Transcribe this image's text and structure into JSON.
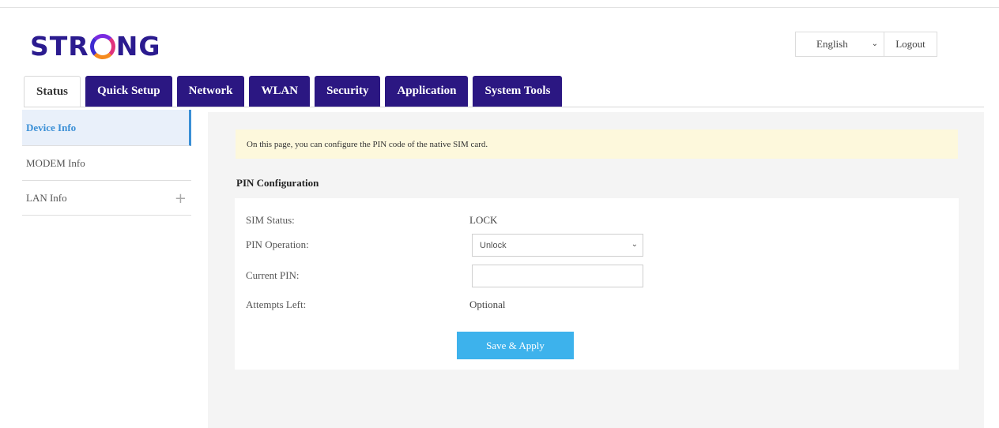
{
  "brand": {
    "logo_text_before": "STR",
    "logo_text_after": "NG",
    "logo_colors": [
      "#2b1b8f",
      "#7a2ae0",
      "#e0327c",
      "#f58a1f"
    ]
  },
  "header": {
    "language": {
      "selected": "English"
    },
    "logout_label": "Logout"
  },
  "tabs": [
    {
      "label": "Status",
      "active": true
    },
    {
      "label": "Quick Setup",
      "active": false
    },
    {
      "label": "Network",
      "active": false
    },
    {
      "label": "WLAN",
      "active": false
    },
    {
      "label": "Security",
      "active": false
    },
    {
      "label": "Application",
      "active": false
    },
    {
      "label": "System Tools",
      "active": false
    }
  ],
  "sidebar": {
    "items": [
      {
        "label": "Device Info",
        "active": true
      },
      {
        "label": "MODEM Info",
        "active": false
      },
      {
        "label": "LAN Info",
        "active": false,
        "expand_icon": "plus-icon"
      }
    ]
  },
  "main": {
    "notice": "On this page, you can configure the PIN code of the native SIM card.",
    "section_title": "PIN Configuration",
    "form": {
      "sim_status": {
        "label": "SIM Status:",
        "value": "LOCK"
      },
      "pin_operation": {
        "label": "PIN Operation:",
        "selected": "Unlock"
      },
      "current_pin": {
        "label": "Current PIN:",
        "value": ""
      },
      "attempts_left": {
        "label": "Attempts Left:",
        "value": "Optional"
      }
    },
    "apply_label": "Save & Apply"
  },
  "colors": {
    "tab_bg": "#2b1782",
    "accent": "#3a8fd6",
    "button": "#3db2ec",
    "notice_bg": "#fdf8dc"
  }
}
